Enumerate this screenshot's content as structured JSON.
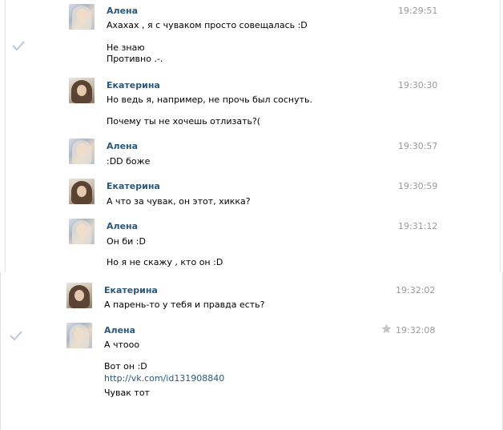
{
  "messages": [
    {
      "author": "Алена",
      "time": "19:29:51",
      "lines": [
        "Ахахах , я с чуваком просто совещалась :D"
      ]
    },
    {
      "author": "",
      "time": "",
      "lines": [
        "Не знаю",
        "Противно .-."
      ]
    },
    {
      "author": "Екатерина",
      "time": "19:30:30",
      "lines": [
        "Но ведь я, например, не прочь был соснуть."
      ]
    },
    {
      "author": "",
      "time": "",
      "lines": [
        "Почему ты не хочешь отлизать?("
      ]
    },
    {
      "author": "Алена",
      "time": "19:30:57",
      "lines": [
        ":DD боже"
      ]
    },
    {
      "author": "Екатерина",
      "time": "19:30:59",
      "lines": [
        "А что за чувак, он этот, хикка?"
      ]
    },
    {
      "author": "Алена",
      "time": "19:31:12",
      "lines": [
        "Он би :D"
      ]
    },
    {
      "author": "",
      "time": "",
      "lines": [
        "Но я не скажу , кто он :D"
      ]
    },
    {
      "author": "Екатерина",
      "time": "19:32:02",
      "lines": [
        "А парень-то у тебя и правда есть?"
      ]
    },
    {
      "author": "Алена",
      "time": "19:32:08",
      "lines": [
        "А чтооо"
      ]
    },
    {
      "author": "",
      "time": "",
      "lines": [
        "Вот он :D",
        "http://vk.com/id131908840",
        "Чувак тот"
      ]
    }
  ],
  "colors": {
    "author_name": "#2b587a",
    "time": "#999999",
    "link": "#2b587a",
    "check": "#b8c9db",
    "star": "#c4c4c4"
  },
  "icons": {
    "read_check": "check-icon",
    "favorite": "star-icon"
  }
}
